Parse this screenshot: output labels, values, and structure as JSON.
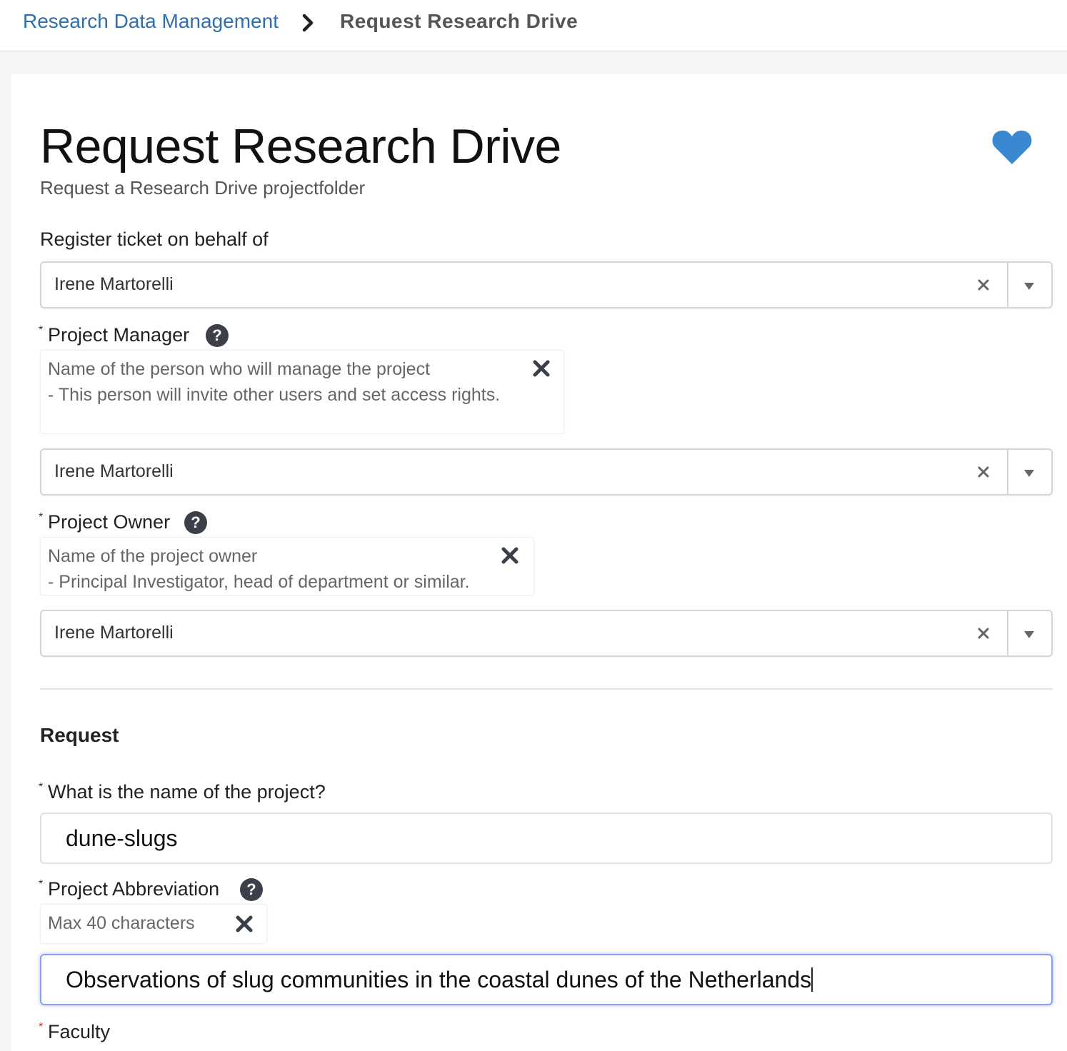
{
  "breadcrumb": {
    "parent": "Research Data Management",
    "current": "Request Research Drive"
  },
  "page": {
    "title": "Request Research Drive",
    "subtitle": "Request a Research Drive projectfolder",
    "favorite_color": "#3a87d2"
  },
  "form": {
    "behalf": {
      "label": "Register ticket on behalf of",
      "value": "Irene Martorelli"
    },
    "manager": {
      "label": "Project Manager",
      "hint_line1": "Name of the person who will manage the project",
      "hint_line2": "- This person will invite other users and set access rights.",
      "value": "Irene Martorelli"
    },
    "owner": {
      "label": "Project Owner",
      "hint_line1": "Name of the project owner",
      "hint_line2": "- Principal Investigator, head of department or similar.",
      "value": "Irene Martorelli"
    },
    "section_title": "Request",
    "project_name": {
      "label": "What is the name of the project?",
      "value": "dune-slugs"
    },
    "abbreviation": {
      "label": "Project Abbreviation",
      "hint": "Max 40 characters",
      "value": "Observations of slug communities in the coastal dunes of the Netherlands"
    },
    "faculty": {
      "label": "Faculty"
    },
    "help_glyph": "?"
  }
}
